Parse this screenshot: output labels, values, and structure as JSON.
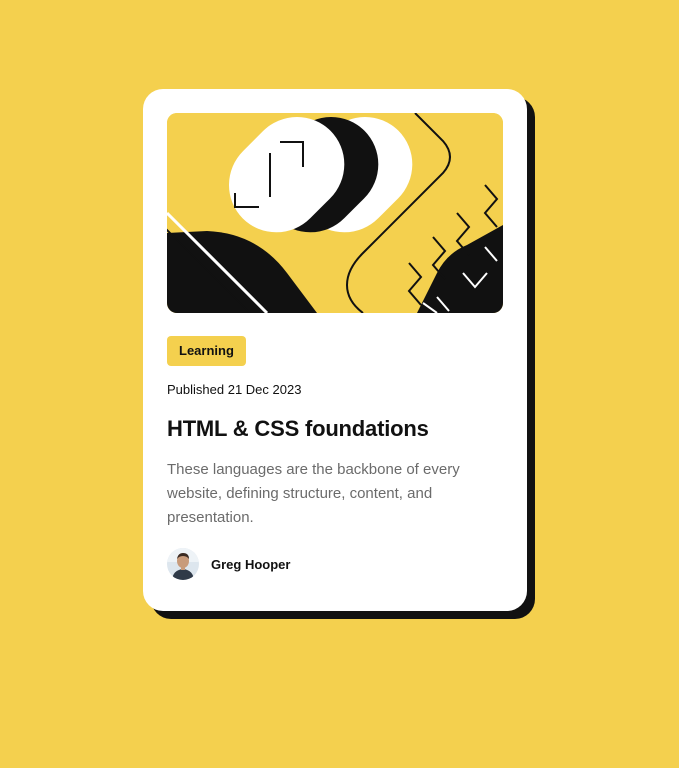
{
  "card": {
    "category": "Learning",
    "published": "Published 21 Dec 2023",
    "title": "HTML & CSS foundations",
    "description": "These languages are the backbone of every website, defining structure, content, and presentation.",
    "author": {
      "name": "Greg Hooper"
    }
  },
  "colors": {
    "background": "#F4D04E",
    "card": "#FFFFFF",
    "shadow": "#111111",
    "text": "#111111",
    "muted": "#6B6B6B"
  }
}
